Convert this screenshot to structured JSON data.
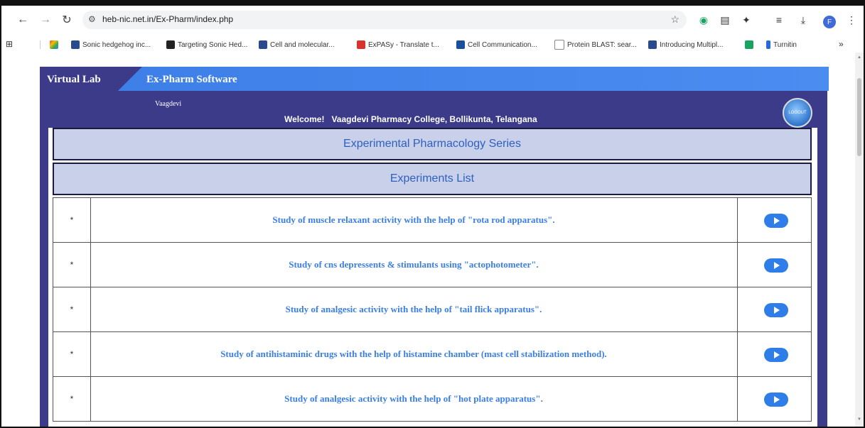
{
  "browser": {
    "url": "heb-nic.net.in/Ex-Pharm/index.php",
    "bookmarks": [
      "Sonic hedgehog inc...",
      "Targeting Sonic Hed...",
      "Cell and molecular...",
      "ExPASy - Translate t...",
      "Cell Communication...",
      "Protein BLAST: sear...",
      "Introducing Multipl...",
      "",
      "Turnitin"
    ],
    "more": "»",
    "avatar": "F"
  },
  "site": {
    "lab_name": "Virtual Lab",
    "software_name": "Ex-Pharm Software",
    "user": "Vaagdevi",
    "welcome_label": "Welcome!",
    "welcome_text": "Vaagdevi Pharmacy College, Bollikunta, Telangana",
    "logout": "LOGOUT"
  },
  "headers": {
    "series": "Experimental Pharmacology Series",
    "list": "Experiments List"
  },
  "experiments": [
    {
      "marker": "*",
      "title": "Study of muscle relaxant activity with the help of \"rota rod apparatus\"."
    },
    {
      "marker": "*",
      "title": "Study of cns depressents & stimulants using \"actophotometer\"."
    },
    {
      "marker": "*",
      "title": "Study of analgesic activity with the help of \"tail flick apparatus\"."
    },
    {
      "marker": "*",
      "title": "Study of antihistaminic drugs with the help of histamine chamber (mast cell stabilization method)."
    },
    {
      "marker": "*",
      "title": "Study of analgesic activity with the help of \"hot plate apparatus\"."
    }
  ]
}
